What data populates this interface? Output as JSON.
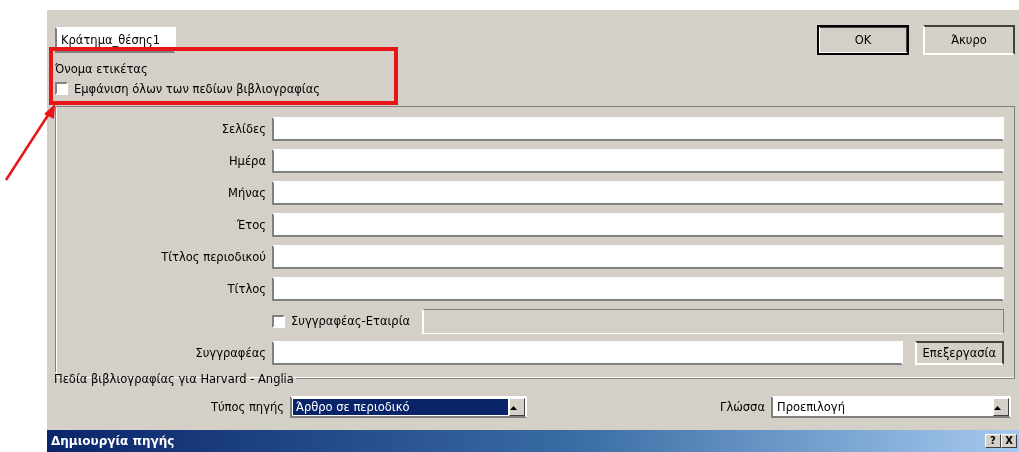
{
  "window": {
    "title": "Δημιουργία πηγής",
    "help_button": "?",
    "close_button": "X"
  },
  "source_type": {
    "label": "Τύπος πηγής",
    "value": "Άρθρο σε περιοδικό",
    "focused": true
  },
  "language": {
    "label": "Γλώσσα",
    "value": "Προεπιλογή",
    "focused": false
  },
  "fields_group": {
    "title": "Πεδία βιβλιογραφίας για Harvard - Anglia",
    "author": {
      "label": "Συγγραφέας",
      "button": "Επεξεργασία"
    },
    "corporate_author": {
      "label": "Συγγραφέας-Εταιρία",
      "checked": false
    },
    "fields": [
      {
        "label": "Σελίδες"
      },
      {
        "label": "Ημέρα"
      },
      {
        "label": "Μήνας"
      },
      {
        "label": "Έτος"
      },
      {
        "label": "Τίτλος περιοδικού"
      },
      {
        "label": "Τίτλος"
      }
    ]
  },
  "show_all": {
    "label": "Εμφάνιση όλων των πεδίων βιβλιογραφίας",
    "checked": false
  },
  "tag_name": {
    "label": "Όνομα ετικέτας",
    "value": "Κράτημα_θέσης1"
  },
  "buttons": [
    {
      "label": "OK",
      "default": true
    },
    {
      "label": "Άκυρο",
      "default": false
    }
  ]
}
